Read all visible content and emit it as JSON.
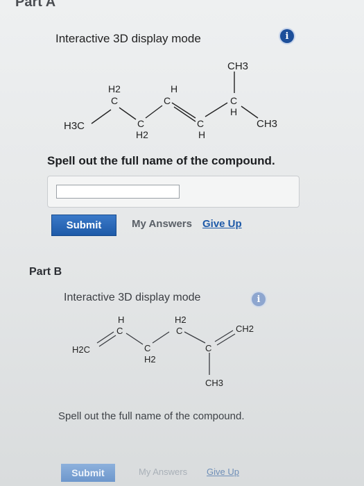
{
  "part_a": {
    "header": "Part A",
    "display_mode": "Interactive 3D display mode",
    "info_icon": "info-icon",
    "question": "Spell out the full name of the compound.",
    "answer_value": "",
    "submit": "Submit",
    "my_answers": "My Answers",
    "give_up": "Give Up",
    "molecule": {
      "h3c": "H3C",
      "ch2a_h": "H2",
      "ch2a_c": "C",
      "ch2b_c": "C",
      "ch2b_h": "H2",
      "ch1_h": "H",
      "ch1_c": "C",
      "ch2_c": "C",
      "ch2_h": "H",
      "ch3_top": "CH3",
      "c_branch": "C",
      "h_branch": "H",
      "ch3_right": "CH3"
    }
  },
  "part_b": {
    "header": "Part B",
    "display_mode": "Interactive 3D display mode",
    "info_icon": "info-icon",
    "question": "Spell out the full name of the compound.",
    "submit": "Submit",
    "my_answers": "My Answers",
    "give_up": "Give Up",
    "molecule": {
      "h2c_left": "H2C",
      "c1_h": "H",
      "c1_c": "C",
      "c2_c": "C",
      "c2_h": "H2",
      "c3_h": "H2",
      "c3_c": "C",
      "c4_c": "C",
      "ch2_right": "CH2",
      "ch3_bottom": "CH3"
    }
  },
  "colors": {
    "submit_blue": "#1e5aa8",
    "link_blue": "#1e5aa8",
    "info_blue": "#1d4f9a"
  }
}
